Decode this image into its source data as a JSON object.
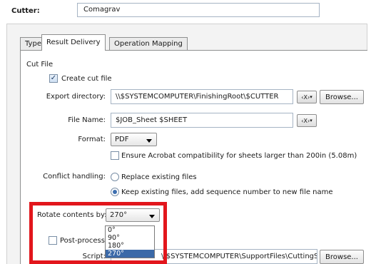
{
  "cutter": {
    "label": "Cutter:",
    "value": "Comagrav"
  },
  "tabs": [
    {
      "label": "Type",
      "active": false
    },
    {
      "label": "Result Delivery",
      "active": true
    },
    {
      "label": "Operation Mapping",
      "active": false
    }
  ],
  "cut_file": {
    "section_label": "Cut File",
    "create_checkbox": {
      "label": "Create cut file",
      "checked": true
    },
    "export_directory": {
      "label": "Export directory:",
      "value": "\\\\$SYSTEMCOMPUTER\\FinishingRoot\\$CUTTER",
      "var_button": "‹X›",
      "browse_label": "Browse..."
    },
    "file_name": {
      "label": "File Name:",
      "value": "$JOB_Sheet $SHEET",
      "var_button": "‹X›"
    },
    "format": {
      "label": "Format:",
      "value": "PDF"
    },
    "acrobat_checkbox": {
      "label": "Ensure Acrobat compatibility for sheets larger than 200in (5.08m)",
      "checked": false
    },
    "conflict": {
      "label": "Conflict handling:",
      "options": [
        {
          "label": "Replace existing files",
          "selected": false
        },
        {
          "label": "Keep existing files, add sequence number to new file name",
          "selected": true
        }
      ]
    },
    "rotate": {
      "label": "Rotate contents by:",
      "value": "270°",
      "options": [
        "0°",
        "90°",
        "180°",
        "270°"
      ],
      "selected_index": 3
    },
    "post_process": {
      "label": "Post-process fi",
      "checked": false
    },
    "script": {
      "label": "Script:",
      "value": "\\\\$SYSTEMCOMPUTER\\SupportFiles\\CuttingScripts\\EPS_Conv",
      "browse_label": "Browse..."
    }
  },
  "colors": {
    "highlight_box": "#e2161c",
    "selected_option": "#3b69a8"
  }
}
